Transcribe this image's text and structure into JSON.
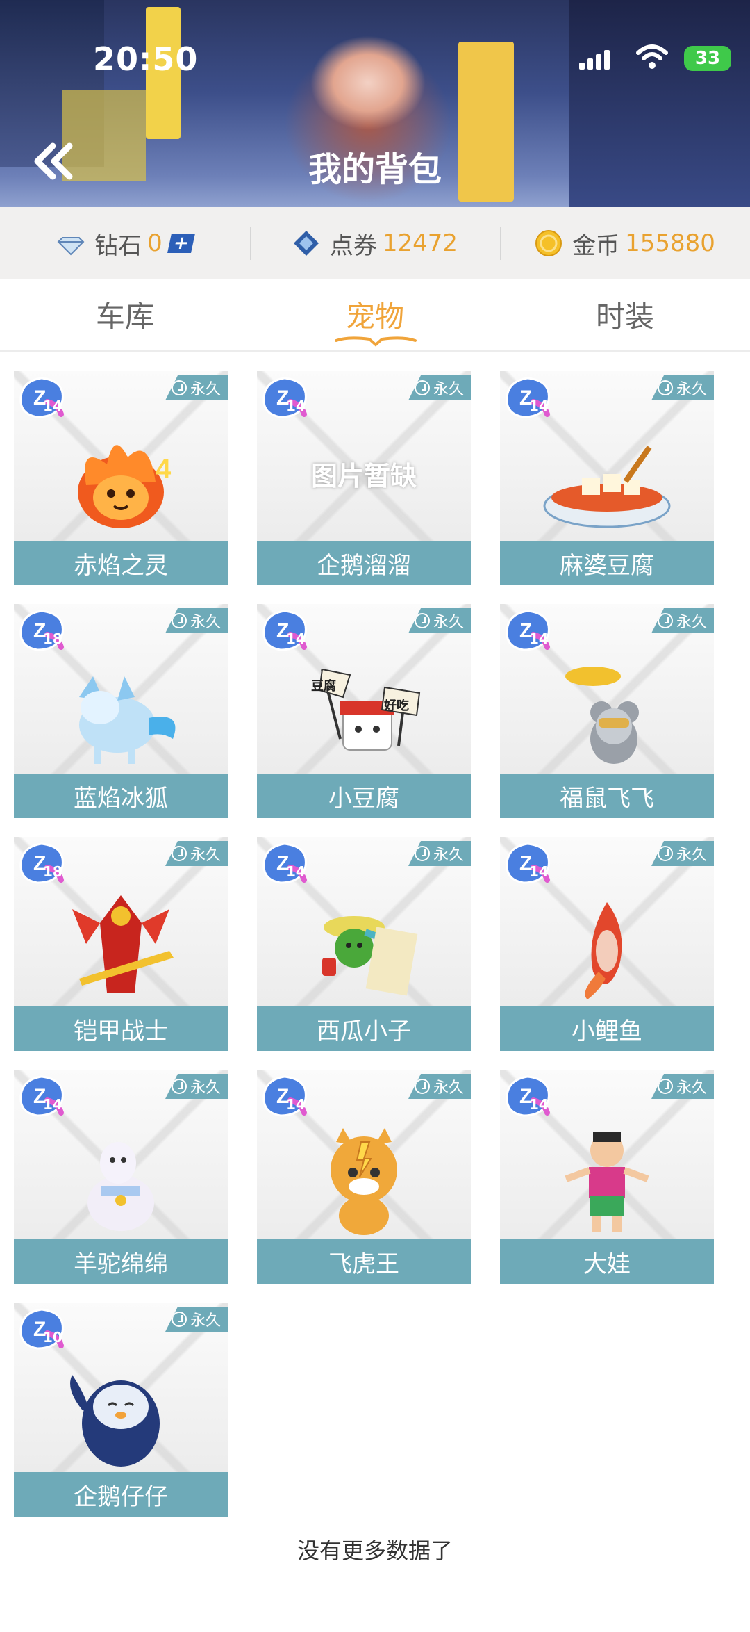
{
  "status": {
    "time": "20:50",
    "battery": "33"
  },
  "header": {
    "title": "我的背包"
  },
  "currency": [
    {
      "label": "钻石",
      "value": "0",
      "icon": "diamond-icon"
    },
    {
      "label": "点券",
      "value": "12472",
      "icon": "voucher-icon"
    },
    {
      "label": "金币",
      "value": "155880",
      "icon": "gold-coin-icon"
    }
  ],
  "tabs": [
    {
      "label": "车库",
      "active": false
    },
    {
      "label": "宠物",
      "active": true
    },
    {
      "label": "时装",
      "active": false
    }
  ],
  "pets": [
    {
      "name": "赤焰之灵",
      "level": "14",
      "tag": "永久",
      "art": "fire-spirit"
    },
    {
      "name": "企鹅溜溜",
      "level": "14",
      "tag": "永久",
      "art": "missing",
      "missing_text": "图片暂缺"
    },
    {
      "name": "麻婆豆腐",
      "level": "14",
      "tag": "永久",
      "art": "tofu-bowl"
    },
    {
      "name": "蓝焰冰狐",
      "level": "18",
      "tag": "永久",
      "art": "ice-fox"
    },
    {
      "name": "小豆腐",
      "level": "14",
      "tag": "永久",
      "art": "little-tofu",
      "flags": [
        "豆腐",
        "好吃"
      ]
    },
    {
      "name": "福鼠飞飞",
      "level": "14",
      "tag": "永久",
      "art": "flying-mouse"
    },
    {
      "name": "铠甲战士",
      "level": "18",
      "tag": "永久",
      "art": "armor-warrior"
    },
    {
      "name": "西瓜小子",
      "level": "14",
      "tag": "永久",
      "art": "watermelon-kid"
    },
    {
      "name": "小鲤鱼",
      "level": "14",
      "tag": "永久",
      "art": "koi-fish"
    },
    {
      "name": "羊驼绵绵",
      "level": "14",
      "tag": "永久",
      "art": "alpaca"
    },
    {
      "name": "飞虎王",
      "level": "14",
      "tag": "永久",
      "art": "tiger-king"
    },
    {
      "name": "大娃",
      "level": "14",
      "tag": "永久",
      "art": "calabash-kid"
    },
    {
      "name": "企鹅仔仔",
      "level": "10",
      "tag": "永久",
      "art": "blue-penguin"
    }
  ],
  "footer": {
    "message": "没有更多数据了"
  },
  "colors": {
    "accent": "#f0a43a",
    "card_label_bg": "#6eaab8",
    "currency_value": "#e9a230"
  }
}
